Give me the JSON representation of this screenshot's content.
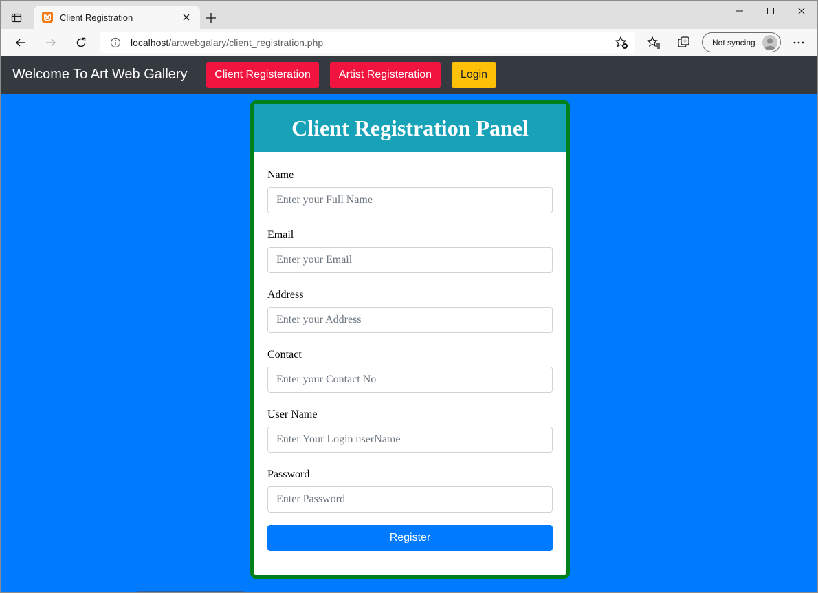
{
  "browser": {
    "tab_title": "Client Registration",
    "url_host": "localhost",
    "url_path": "/artwebgalary/client_registration.php",
    "profile_label": "Not syncing"
  },
  "site_nav": {
    "brand": "Welcome To Art Web Gallery",
    "client_registration_label": "Client Registeration",
    "artist_registration_label": "Artist Registeration",
    "login_label": "Login"
  },
  "panel": {
    "title": "Client Registration Panel",
    "fields": [
      {
        "label": "Name",
        "placeholder": "Enter your Full Name",
        "value": ""
      },
      {
        "label": "Email",
        "placeholder": "Enter your Email",
        "value": ""
      },
      {
        "label": "Address",
        "placeholder": "Enter your Address",
        "value": ""
      },
      {
        "label": "Contact",
        "placeholder": "Enter your Contact No",
        "value": ""
      },
      {
        "label": "User Name",
        "placeholder": "Enter Your Login userName",
        "value": ""
      },
      {
        "label": "Password",
        "placeholder": "Enter Password",
        "value": ""
      }
    ],
    "submit_label": "Register"
  },
  "icons": {
    "tab_actions": "tab-actions-icon",
    "favicon": "xampp-favicon-icon",
    "tab_close": "close-icon",
    "new_tab": "plus-icon",
    "minimize": "minimize-icon",
    "maximize": "maximize-icon",
    "close_window": "close-icon",
    "back": "back-arrow-icon",
    "forward": "forward-arrow-icon",
    "refresh": "refresh-icon",
    "site_info": "info-icon",
    "add_favorite": "add-favorite-icon",
    "favorites": "favorites-icon",
    "collections": "collections-icon",
    "more": "more-icon"
  },
  "colors": {
    "page_background": "#007bff",
    "navbar": "#343a40",
    "panel_border": "#00801a",
    "panel_header": "#17a2b8",
    "danger_button": "#f0143e",
    "warning_button": "#ffc107",
    "primary_button": "#007bff"
  }
}
